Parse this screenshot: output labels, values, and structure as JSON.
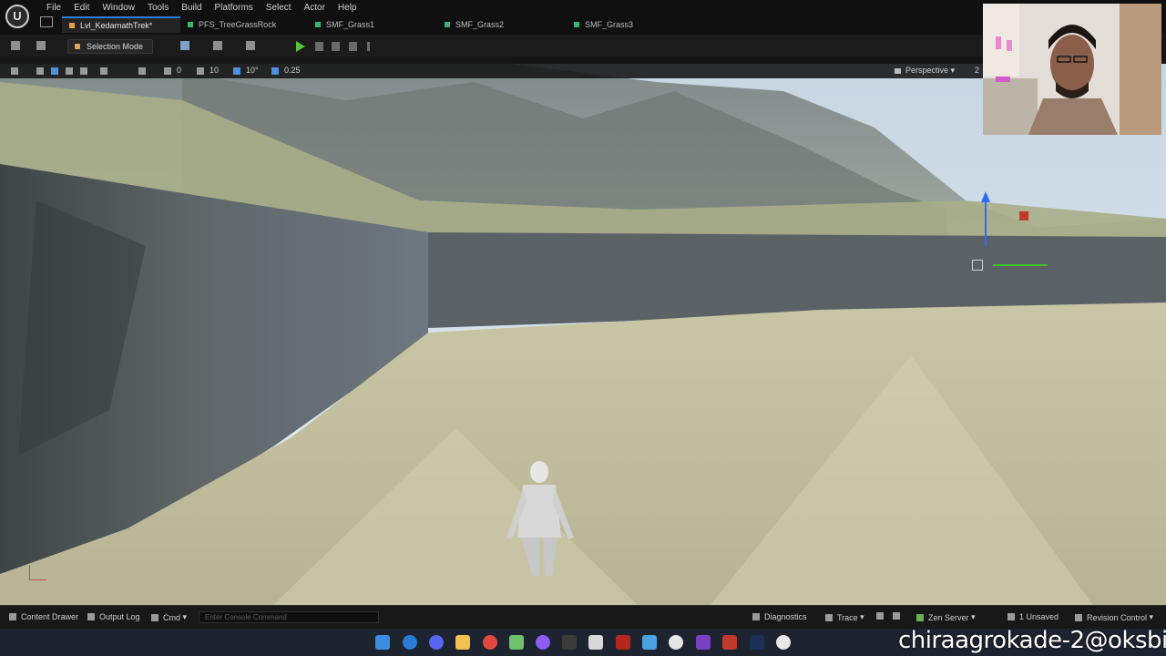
{
  "menu": [
    "File",
    "Edit",
    "Window",
    "Tools",
    "Build",
    "Platforms",
    "Select",
    "Actor",
    "Help"
  ],
  "tabs": [
    {
      "label": "Lvl_KedarnathTrek*",
      "active": true,
      "color": "#e8a23a"
    },
    {
      "label": "PFS_TreeGrassRock",
      "active": false,
      "color": "#39b86a"
    },
    {
      "label": "SMF_Grass1",
      "active": false,
      "color": "#39b86a"
    },
    {
      "label": "SMF_Grass2",
      "active": false,
      "color": "#39b86a"
    },
    {
      "label": "SMF_Grass3",
      "active": false,
      "color": "#39b86a"
    }
  ],
  "toolbar": {
    "mode_label": "Selection Mode"
  },
  "viewport": {
    "grid_snap": "10",
    "rotation_snap": "10°",
    "scale_snap": "0.25",
    "zero_value": "0",
    "view_mode": "Perspective",
    "layout_num": "2"
  },
  "status": {
    "content_drawer": "Content Drawer",
    "output_log": "Output Log",
    "cmd": "Cmd",
    "console_placeholder": "Enter Console Command",
    "diagnostics": "Diagnostics",
    "trace": "Trace",
    "zen_server": "Zen Server",
    "unsaved": "1 Unsaved",
    "revision_control": "Revision Control"
  },
  "watermark": "chiraagrokade-2@oksbi",
  "colors": {
    "accent": "#2d7dd8",
    "play": "#57c43d",
    "gizmo_z": "#2d6bff",
    "gizmo_x": "#3fbf2a",
    "gizmo_red": "#c0392b"
  }
}
